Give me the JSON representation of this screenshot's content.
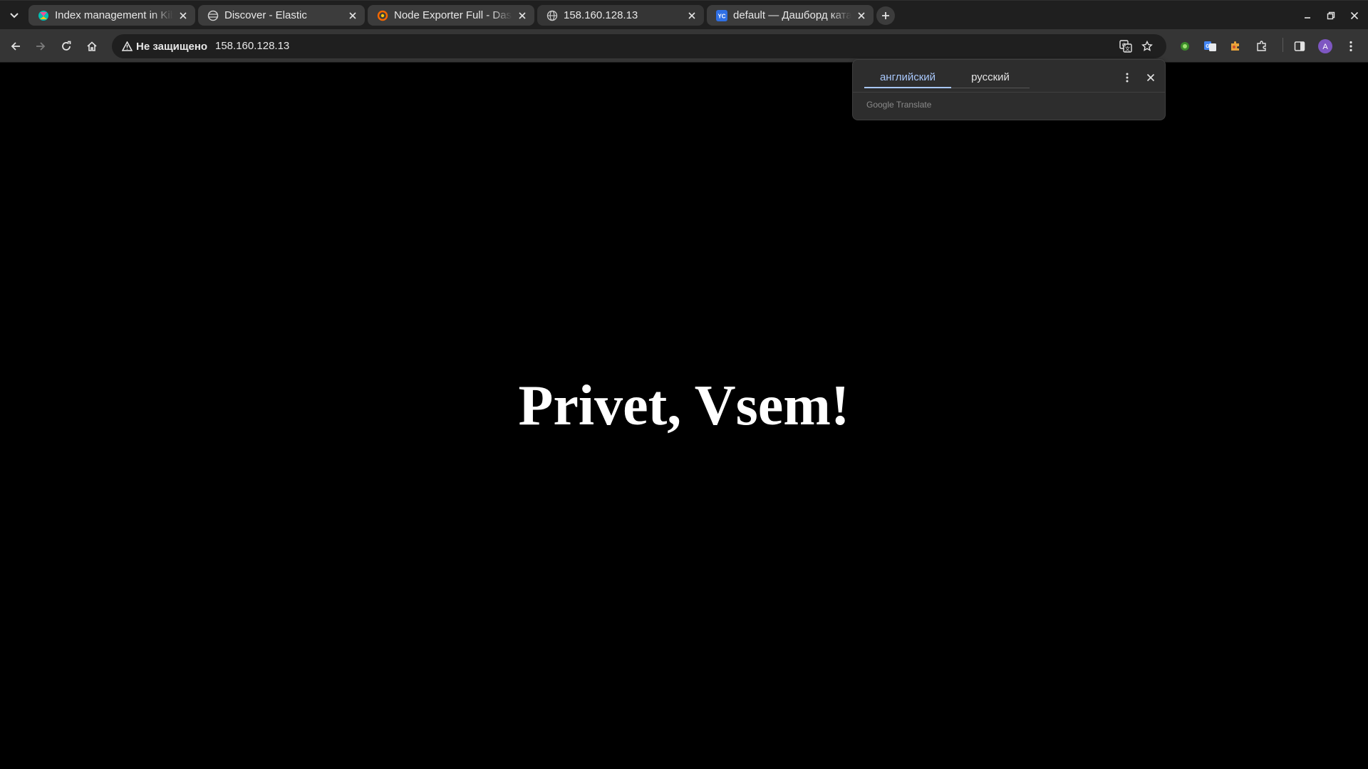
{
  "browser": {
    "tabs": [
      {
        "title": "Index management in Kibana",
        "favicon": "kibana-icon",
        "active": false
      },
      {
        "title": "Discover - Elastic",
        "favicon": "elastic-icon",
        "active": false
      },
      {
        "title": "Node Exporter Full - Dashboards - Grafana",
        "favicon": "grafana-icon",
        "active": false
      },
      {
        "title": "158.160.128.13",
        "favicon": "globe-icon",
        "active": true
      },
      {
        "title": "default — Дашборд каталога",
        "favicon": "yandex-cloud-icon",
        "active": false
      }
    ],
    "address_bar": {
      "security_label": "Не защищено",
      "url": "158.160.128.13"
    }
  },
  "page": {
    "heading": "Privet, Vsem!"
  },
  "translate_bubble": {
    "source_language": "английский",
    "target_language": "русский",
    "brand": "Google Translate"
  },
  "colors": {
    "accent": "#a8c7fa",
    "page_background": "#000000",
    "heading_text": "#ffffff"
  }
}
